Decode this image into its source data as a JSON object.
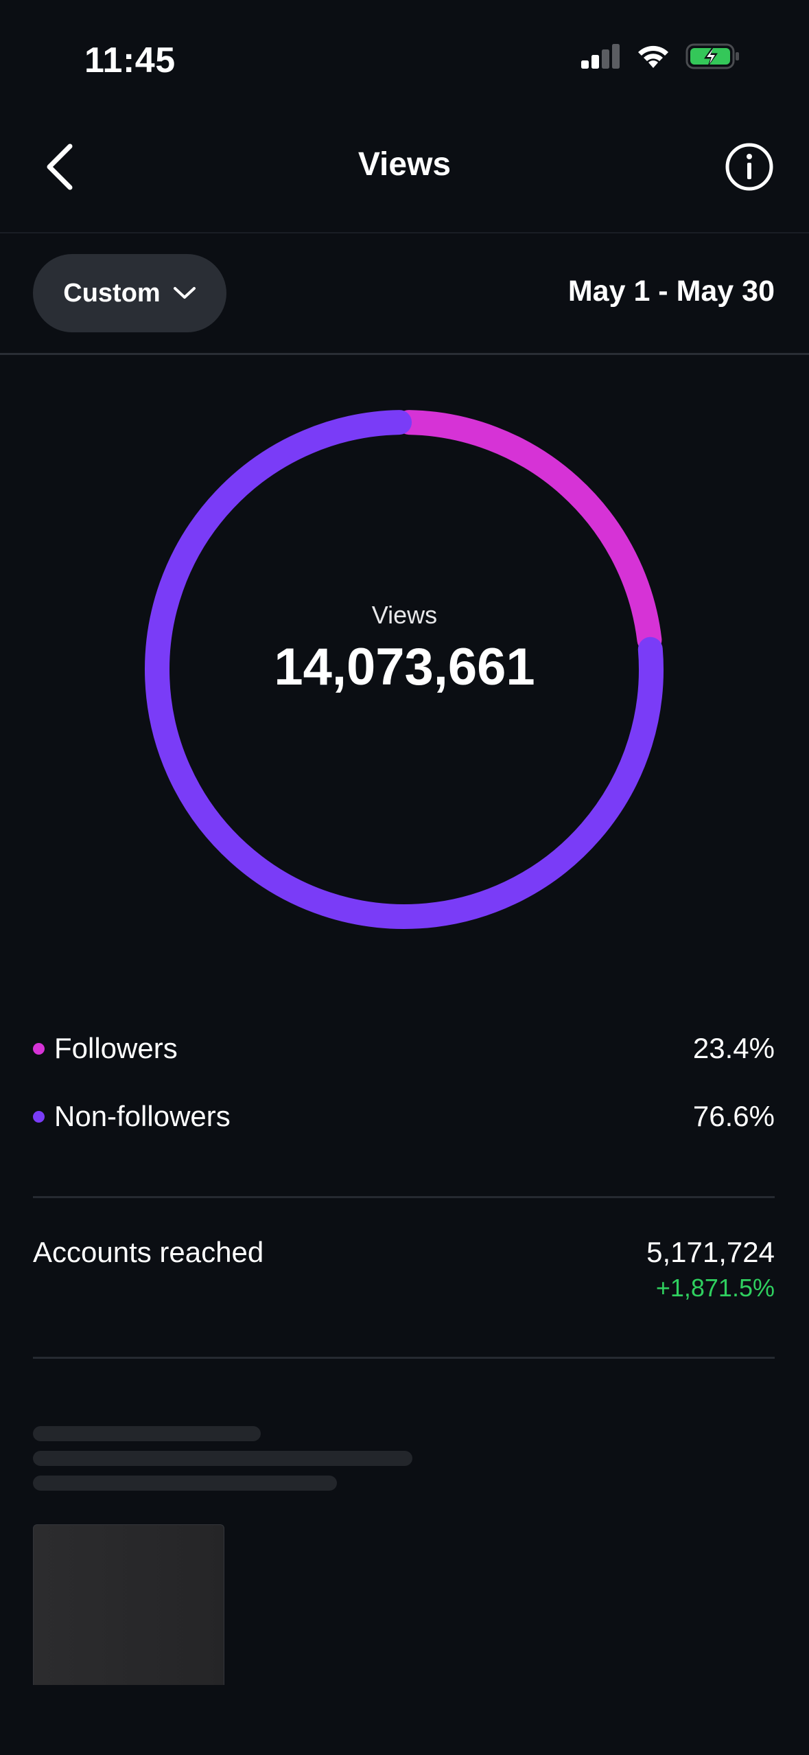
{
  "status_bar": {
    "time": "11:45",
    "icons": [
      "cellular-signal-icon",
      "wifi-icon",
      "battery-charging-icon"
    ]
  },
  "nav": {
    "title": "Views",
    "back_icon": "chevron-left-icon",
    "info_icon": "info-circle-icon"
  },
  "filter": {
    "selected": "Custom",
    "date_range": "May 1 - May 30"
  },
  "donut": {
    "label": "Views",
    "total": "14,073,661"
  },
  "chart_data": {
    "type": "pie",
    "categories": [
      "Followers",
      "Non-followers"
    ],
    "values": [
      23.4,
      76.6
    ],
    "colors": [
      "#d633d6",
      "#7a3cf7"
    ],
    "title": "",
    "center_label": "Views",
    "center_value": "14,073,661"
  },
  "legend": [
    {
      "label": "Followers",
      "value": "23.4%",
      "color": "#d633d6"
    },
    {
      "label": "Non-followers",
      "value": "76.6%",
      "color": "#7a3cf7"
    }
  ],
  "accounts_reached": {
    "label": "Accounts reached",
    "value": "5,171,724",
    "change": "+1,871.5%"
  },
  "colors": {
    "background": "#0b0e13",
    "positive": "#2fd05f",
    "followers": "#d633d6",
    "non_followers": "#7a3cf7"
  }
}
